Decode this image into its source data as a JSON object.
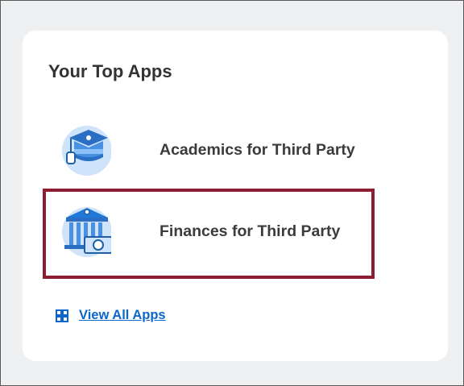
{
  "card": {
    "title": "Your Top Apps",
    "apps": [
      {
        "label": "Academics for Third Party",
        "icon": "graduation-cap-icon"
      },
      {
        "label": "Finances for Third Party",
        "icon": "bank-money-icon",
        "highlighted": true
      }
    ],
    "view_all": {
      "label": "View All Apps",
      "icon": "grid-icon"
    }
  },
  "colors": {
    "accent": "#0b67c9",
    "highlight_border": "#8c1d33",
    "icon_blue": "#1f77d6",
    "icon_light": "#cfe3fb",
    "page_background": "#eff0f2"
  }
}
